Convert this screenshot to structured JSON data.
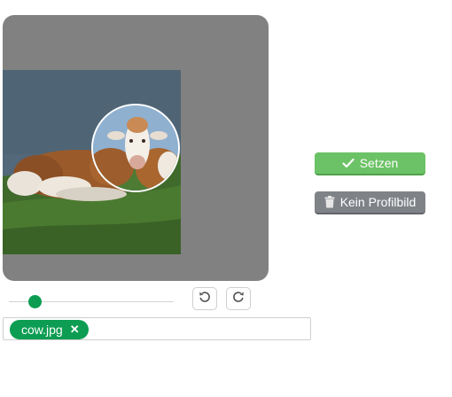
{
  "crop": {
    "image_icon": "cow-photo",
    "zoom_level": 0.13
  },
  "actions": {
    "set_label": "Setzen",
    "set_icon": "checkmark-icon",
    "none_label": "Kein Profilbild",
    "none_icon": "trash-icon"
  },
  "controls": {
    "rotate_left_icon": "rotate-left-icon",
    "rotate_right_icon": "rotate-right-icon"
  },
  "file": {
    "name": "cow.jpg",
    "remove_symbol": "✕"
  },
  "colors": {
    "crop_background": "#818181",
    "primary_green": "#0c9d52",
    "set_button": "#6cc266",
    "none_button": "#7f8388"
  }
}
